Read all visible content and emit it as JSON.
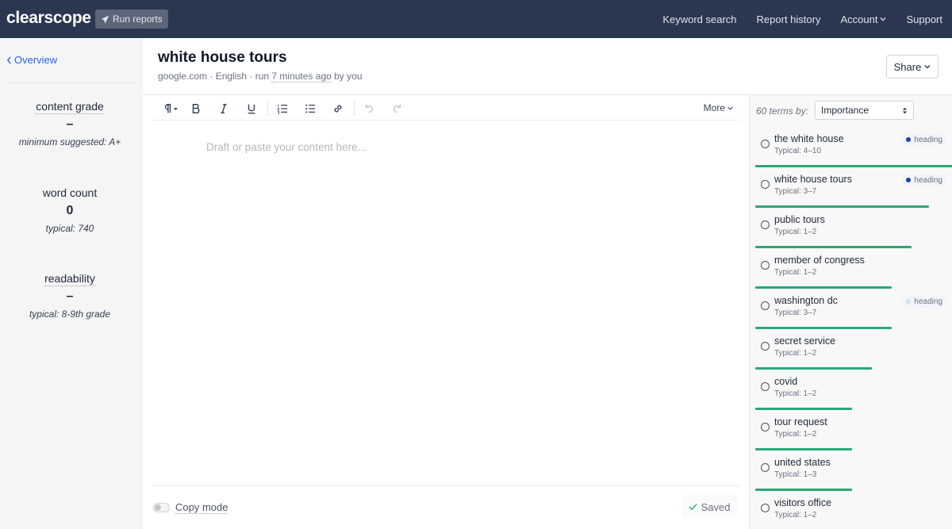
{
  "nav": {
    "logo": "clearscope",
    "run_reports": "Run reports",
    "links": [
      "Keyword search",
      "Report history",
      "Account",
      "Support"
    ]
  },
  "sidebar": {
    "overview": "Overview",
    "content_grade": {
      "label": "content grade",
      "value": "–",
      "sub": "minimum suggested: A+"
    },
    "word_count": {
      "label": "word count",
      "value": "0",
      "sub": "typical: 740"
    },
    "readability": {
      "label": "readability",
      "value": "–",
      "sub": "typical: 8-9th grade"
    }
  },
  "header": {
    "title": "white house tours",
    "meta_prefix": "google.com · English · run ",
    "meta_time": "7 minutes ago",
    "meta_suffix": " by you",
    "share": "Share"
  },
  "editor": {
    "more": "More",
    "placeholder": "Draft or paste your content here...",
    "copy_mode": "Copy mode",
    "saved": "Saved"
  },
  "terms_panel": {
    "count_label": "60 terms by:",
    "sort_value": "Importance",
    "colors": {
      "bar": "#2aa876",
      "heading_dot": "#1e40af"
    },
    "terms": [
      {
        "name": "the white house",
        "typical": "Typical: 4–10",
        "badge": "heading",
        "badge_style": "dark",
        "importance": 1.0
      },
      {
        "name": "white house tours",
        "typical": "Typical: 3–7",
        "badge": "heading",
        "badge_style": "dark",
        "importance": 0.88
      },
      {
        "name": "public tours",
        "typical": "Typical: 1–2",
        "badge": "",
        "badge_style": "",
        "importance": 0.79
      },
      {
        "name": "member of congress",
        "typical": "Typical: 1–2",
        "badge": "",
        "badge_style": "",
        "importance": 0.69
      },
      {
        "name": "washington dc",
        "typical": "Typical: 3–7",
        "badge": "heading",
        "badge_style": "light",
        "importance": 0.69
      },
      {
        "name": "secret service",
        "typical": "Typical: 1–2",
        "badge": "",
        "badge_style": "",
        "importance": 0.59
      },
      {
        "name": "covid",
        "typical": "Typical: 1–2",
        "badge": "",
        "badge_style": "",
        "importance": 0.49
      },
      {
        "name": "tour request",
        "typical": "Typical: 1–2",
        "badge": "",
        "badge_style": "",
        "importance": 0.49
      },
      {
        "name": "united states",
        "typical": "Typical: 1–3",
        "badge": "",
        "badge_style": "",
        "importance": 0.49
      },
      {
        "name": "visitors office",
        "typical": "Typical: 1–2",
        "badge": "",
        "badge_style": "",
        "importance": 0.49
      }
    ]
  }
}
